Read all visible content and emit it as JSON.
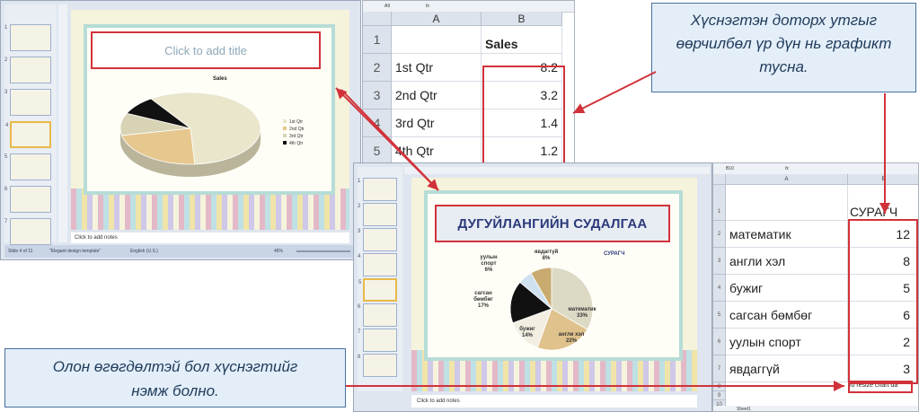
{
  "ppt1": {
    "title_placeholder": "Click to add title",
    "notes_placeholder": "Click to add notes",
    "status": {
      "slide_info": "Slide 4 of 11",
      "theme": "\"Elegant design template\"",
      "language": "English (U.S.)",
      "zoom": "46%"
    },
    "thumbnails": [
      "1",
      "2",
      "3",
      "4",
      "5",
      "6",
      "7",
      "8"
    ]
  },
  "xl1": {
    "cell_ref": "A9",
    "fx": "fx",
    "col_headers": [
      "A",
      "B"
    ],
    "rows": [
      {
        "n": "1",
        "a": "",
        "b": "Sales"
      },
      {
        "n": "2",
        "a": "1st Qtr",
        "b": "8.2"
      },
      {
        "n": "3",
        "a": "2nd Qtr",
        "b": "3.2"
      },
      {
        "n": "4",
        "a": "3rd Qtr",
        "b": "1.4"
      },
      {
        "n": "5",
        "a": "4th Qtr",
        "b": "1.2"
      }
    ]
  },
  "chart_data": [
    {
      "type": "pie",
      "title": "Sales",
      "categories": [
        "1st Qtr",
        "2nd Qtr",
        "3rd Qtr",
        "4th Qtr"
      ],
      "values": [
        8.2,
        3.2,
        1.4,
        1.2
      ],
      "colors": [
        "#e9e6cc",
        "#e6c78e",
        "#d8d3b4",
        "#111111"
      ],
      "legend": "right"
    },
    {
      "type": "pie",
      "title": "СУРАГЧ",
      "categories": [
        "математик",
        "англи хэл",
        "бужиг",
        "сагсан бөмбөг",
        "уулын спорт",
        "явдаггүй"
      ],
      "values": [
        12,
        8,
        5,
        6,
        2,
        3
      ],
      "labels": [
        {
          "name": "математик",
          "pct": "33%"
        },
        {
          "name": "англи хэл",
          "pct": "22%"
        },
        {
          "name": "бужиг",
          "pct": "14%"
        },
        {
          "name": "сагсан бөмбөг",
          "pct": "17%"
        },
        {
          "name": "уулын спорт",
          "pct": "6%"
        },
        {
          "name": "явдаггүй",
          "pct": "8%"
        }
      ],
      "colors": [
        "#dcd9c4",
        "#dfc28c",
        "#f2efe2",
        "#111111",
        "#cfe0ef",
        "#c9ab70"
      ]
    }
  ],
  "ppt2": {
    "title": "ДУГУЙЛАНГИЙН СУДАЛГАА",
    "notes_placeholder": "Click to add notes",
    "thumbnails": [
      "1",
      "2",
      "3",
      "4",
      "5",
      "6",
      "7",
      "8",
      "9"
    ]
  },
  "xl2": {
    "cell_ref": "B10",
    "fx": "fx",
    "col_headers": [
      "A",
      "B"
    ],
    "header_b": "СУРАГЧ",
    "rows": [
      {
        "n": "2",
        "a": "математик",
        "b": "12"
      },
      {
        "n": "3",
        "a": "англи хэл",
        "b": "8"
      },
      {
        "n": "4",
        "a": "бужиг",
        "b": "5"
      },
      {
        "n": "5",
        "a": "сагсан бөмбөг",
        "b": "6"
      },
      {
        "n": "6",
        "a": "уулын спорт",
        "b": "2"
      },
      {
        "n": "7",
        "a": "явдаггүй",
        "b": "3"
      }
    ],
    "resize_note": "To resize chart da",
    "sheet_tab": "Sheet1"
  },
  "callouts": {
    "top_right": "Хүснэгтэн доторх утгыг өөрчилбөл үр дүн нь графикт тусна.",
    "bottom_left": "Олон өгөгдөлтэй бол хүснэгтийг нэмж болно."
  }
}
